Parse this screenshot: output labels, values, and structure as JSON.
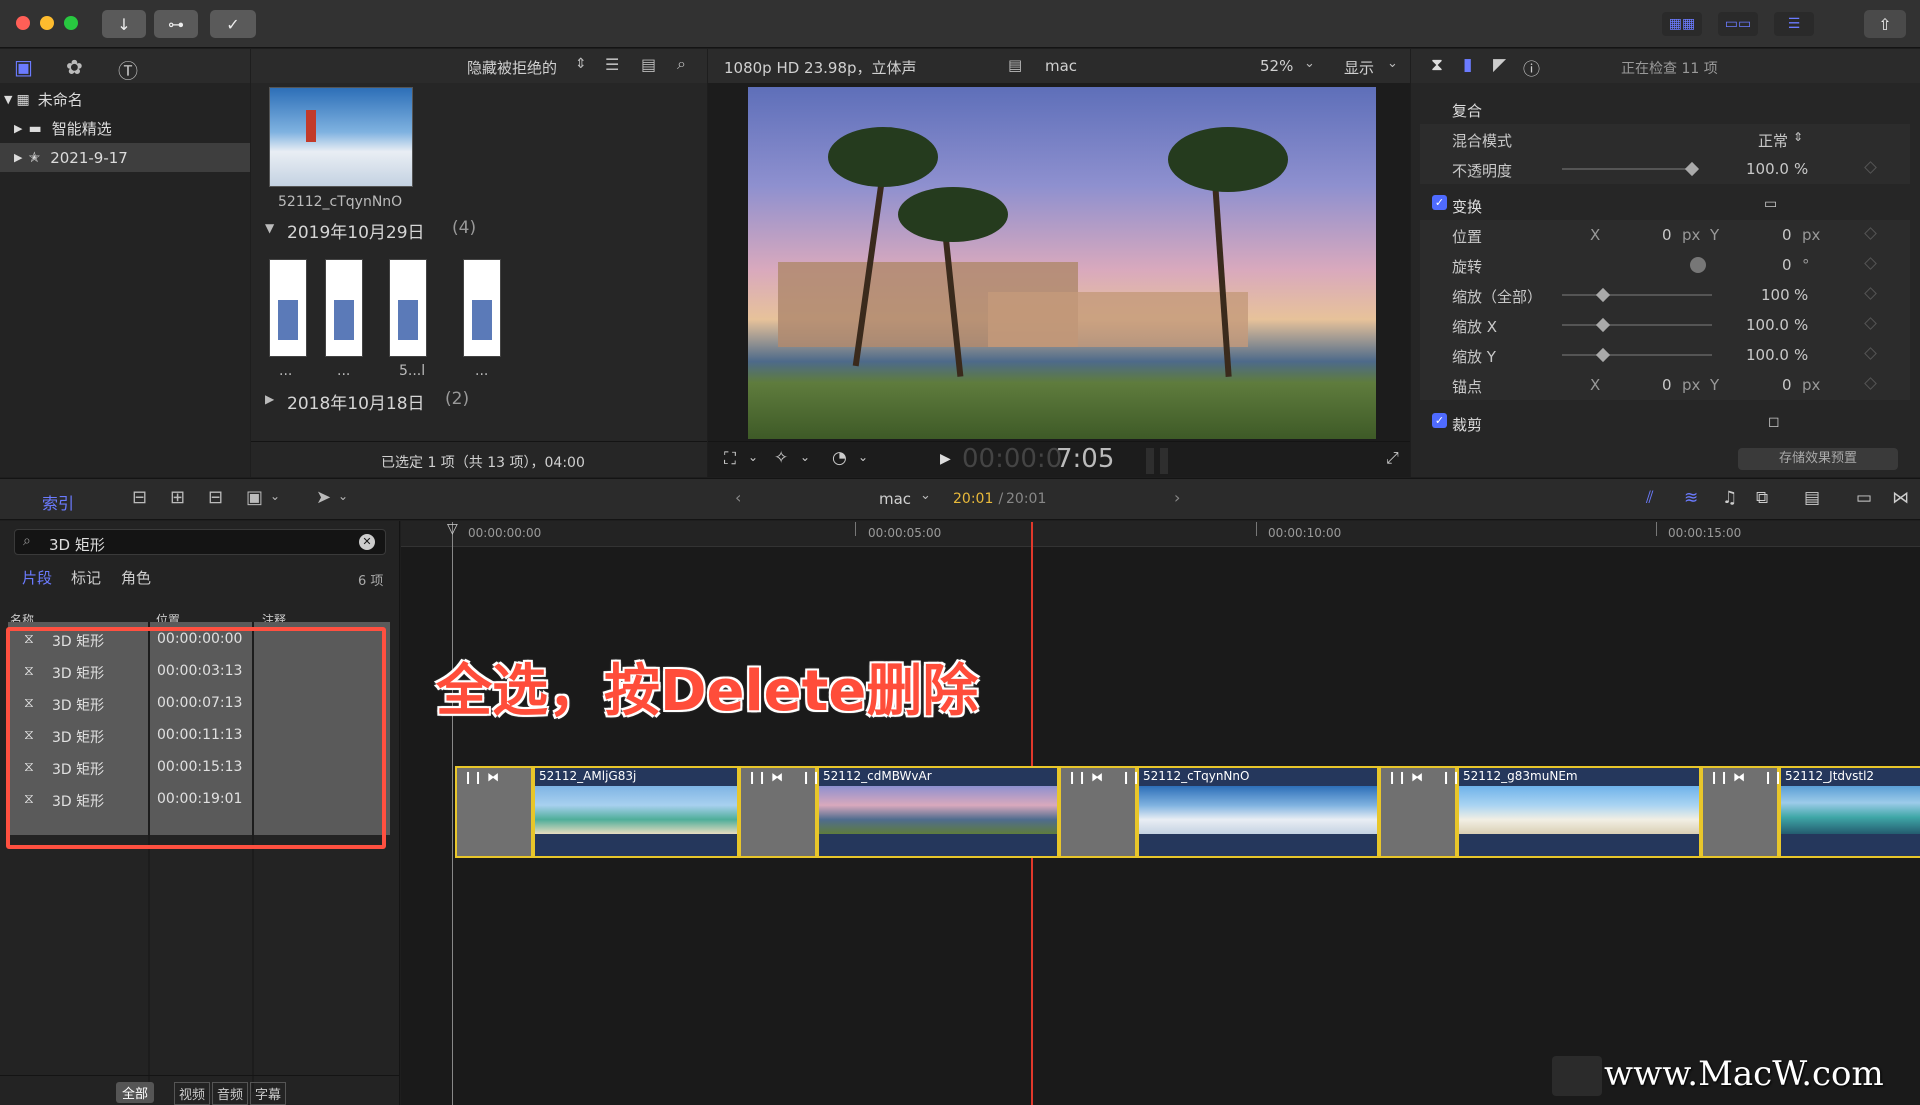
{
  "toolbar": {
    "icons": [
      "import-icon",
      "key-icon",
      "check-icon",
      "share-icon"
    ]
  },
  "library": {
    "header_icons": [
      "clapper-icon",
      "photos-audio-icon",
      "titles-icon"
    ],
    "items": [
      {
        "label": "未命名",
        "expanded": true
      },
      {
        "label": "智能精选",
        "expanded": false
      },
      {
        "label": "2021-9-17",
        "expanded": false,
        "selected": true
      }
    ]
  },
  "browser": {
    "filter_label": "隐藏被拒绝的",
    "clip_name": "52112_cTqynNnO",
    "group1_date": "2019年10月29日",
    "group1_count": "(4)",
    "thumb_labels": [
      "...",
      "...",
      "5...l",
      "..."
    ],
    "group2_date": "2018年10月18日",
    "group2_count": "(2)",
    "status": "已选定 1 项（共 13 项），04:00"
  },
  "viewer": {
    "format": "1080p HD 23.98p，立体声",
    "project": "mac",
    "zoom": "52%",
    "display_label": "显示",
    "timecode_dim": "00:00:0",
    "timecode_bright": "7:05"
  },
  "inspector": {
    "status": "正在检查 11 项",
    "composite_title": "复合",
    "blend_label": "混合模式",
    "blend_value": "正常",
    "opacity_label": "不透明度",
    "opacity_value": "100.0",
    "percent": "%",
    "transform_title": "变换",
    "position_label": "位置",
    "x_label": "X",
    "y_label": "Y",
    "position_x": "0",
    "position_y": "0",
    "px": "px",
    "rotation_label": "旋转",
    "rotation_value": "0",
    "degree": "°",
    "scale_all_label": "缩放（全部）",
    "scale_all_value": "100",
    "scale_x_label": "缩放 X",
    "scale_x_value": "100.0",
    "scale_y_label": "缩放 Y",
    "scale_y_value": "100.0",
    "anchor_label": "锚点",
    "anchor_x": "0",
    "anchor_y": "0",
    "crop_title": "裁剪",
    "save_preset": "存储效果预置",
    "opacity_level": 1.0,
    "scale_level": 0.27
  },
  "timeline_bar": {
    "index_tab": "索引",
    "project": "mac",
    "time_current": "20:01",
    "time_sep": " / ",
    "time_total": "20:01"
  },
  "index": {
    "search_value": "3D 矩形",
    "tabs": [
      "片段",
      "标记",
      "角色"
    ],
    "count": "6 项",
    "columns": [
      "名称",
      "位置",
      "注释"
    ],
    "rows": [
      {
        "name": "3D 矩形",
        "position": "00:00:00:00"
      },
      {
        "name": "3D 矩形",
        "position": "00:00:03:13"
      },
      {
        "name": "3D 矩形",
        "position": "00:00:07:13"
      },
      {
        "name": "3D 矩形",
        "position": "00:00:11:13"
      },
      {
        "name": "3D 矩形",
        "position": "00:00:15:13"
      },
      {
        "name": "3D 矩形",
        "position": "00:00:19:01"
      }
    ],
    "bottom_all": "全部",
    "bottom_tabs": [
      "视频",
      "音频",
      "字幕"
    ]
  },
  "timeline": {
    "ruler": [
      "00:00:00:00",
      "00:00:05:00",
      "00:00:10:00",
      "00:00:15:00"
    ],
    "annotation": "全选，按Delete删除",
    "clips": [
      "52112_AMljG83j",
      "52112_cdMBWvAr",
      "52112_cTqynNnO",
      "52112_g83muNEm",
      "52112_Jtdvstl2"
    ]
  },
  "watermark": "www.MacW.com",
  "colors": {
    "accent": "#4f6bff",
    "selection": "#e8c62a",
    "playhead": "#e0382b",
    "highlight_box": "#ff5040"
  }
}
